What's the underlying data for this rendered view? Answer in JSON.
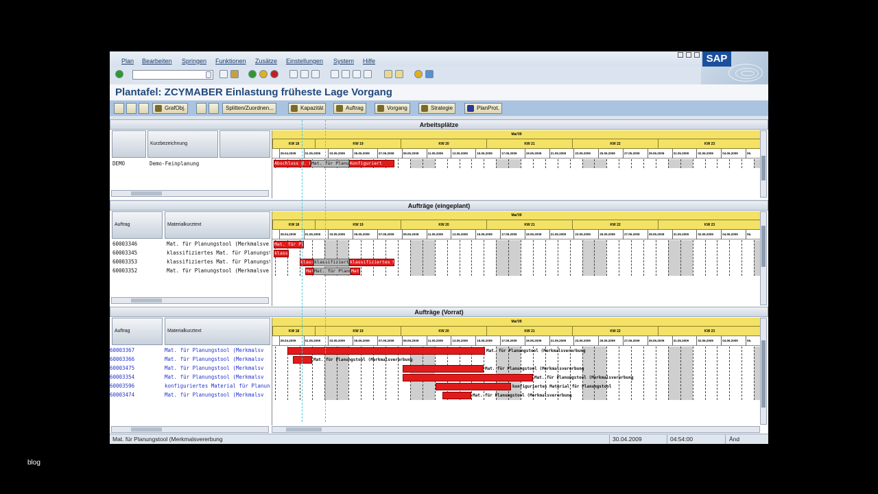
{
  "menu": [
    "Plan",
    "Bearbeiten",
    "Springen",
    "Funktionen",
    "Zusätze",
    "Einstellungen",
    "System",
    "Hilfe"
  ],
  "brand": "SAP",
  "title": "Plantafel: ZCYMABER Einlastung früheste Lage Vorgang",
  "app_toolbar": {
    "grafobj": "GrafObj.",
    "splitten": "Splitten/Zuordnen...",
    "kapazitaet": "Kapazität",
    "auftrag": "Auftrag",
    "vorgang": "Vorgang",
    "strategie": "Strategie",
    "planprot": "PlanProt."
  },
  "timeline": {
    "month": "Mai'09",
    "weeks": [
      "KW 18",
      "KW 19",
      "KW 20",
      "KW 21",
      "KW 22",
      "KW 23"
    ],
    "dates": [
      "2009",
      "29.04.2009",
      "01.05.2009",
      "03.05.2009",
      "05.05.2009",
      "07.05.2009",
      "09.05.2009",
      "11.05.2009",
      "13.05.2009",
      "15.05.2009",
      "17.05.2009",
      "19.05.2009",
      "21.05.2009",
      "23.05.2009",
      "25.05.2009",
      "27.05.2009",
      "29.05.2009",
      "31.05.2009",
      "02.06.2009",
      "04.06.2009",
      "06."
    ]
  },
  "arbeitsplaetze": {
    "title": "Arbeitsplätze",
    "col_kurz": "Kurzbezeichnung",
    "rows": [
      {
        "id": "DEMO",
        "text": "Demo-Feinplanung"
      }
    ],
    "bars": [
      {
        "label": "Abschluss d. Mat.",
        "kind": "red"
      },
      {
        "label": "Mat. für Planungstool",
        "kind": "grey"
      },
      {
        "label": "Konfiguriert",
        "kind": "red"
      }
    ]
  },
  "eingeplant": {
    "title": "Aufträge (eingeplant)",
    "col_auftrag": "Auftrag",
    "col_material": "Materialkurztext",
    "rows": [
      {
        "id": "60003346",
        "text": "Mat. für Planungstool (Merkmalsve"
      },
      {
        "id": "60003345",
        "text": "klassifiziertes Mat. für Planungsto"
      },
      {
        "id": "60003353",
        "text": "klassifiziertes Mat. für Planungsto"
      },
      {
        "id": "60003352",
        "text": "Mat. für Planungstool (Merkmalsve"
      }
    ],
    "bars": [
      {
        "label": "Mat. für Plan"
      },
      {
        "label": "klassifiziert"
      },
      {
        "label": "klassifiziertes Mat. für Planungstool"
      },
      {
        "label": "Mat. für Planungstool"
      }
    ]
  },
  "vorrat": {
    "title": "Aufträge (Vorrat)",
    "col_auftrag": "Auftrag",
    "col_material": "Materialkurztext",
    "rows": [
      {
        "id": "60003367",
        "text": "Mat. für Planungstool (Merkmalsv"
      },
      {
        "id": "60003366",
        "text": "Mat. für Planungstool (Merkmalsv"
      },
      {
        "id": "60003475",
        "text": "Mat. für Planungstool (Merkmalsv"
      },
      {
        "id": "60003354",
        "text": "Mat. für Planungstool (Merkmalsv"
      },
      {
        "id": "60003596",
        "text": "konfiguriertes Material für Planung"
      },
      {
        "id": "60003474",
        "text": "Mat. für Planungstool (Merkmalsv"
      }
    ],
    "bar_labels": [
      "Mat. für Planungstool (Merkmalsvererbung",
      "Mat. für Planungstool (Merkmalsvererbung",
      "Mat. für Planungstool (Merkmalsvererbung",
      "Mat. für Planungstool (Merkmalsvererbung",
      "konfiguriertes Material für Planungstool",
      "Mat. für Planungstool (Merkmalsvererbung"
    ]
  },
  "status": {
    "text": "Mat. für Planungstool (Merkmalsvererbung",
    "date": "30.04.2009",
    "time": "04:54:00",
    "mode": "Änd"
  },
  "overlay": "blog"
}
